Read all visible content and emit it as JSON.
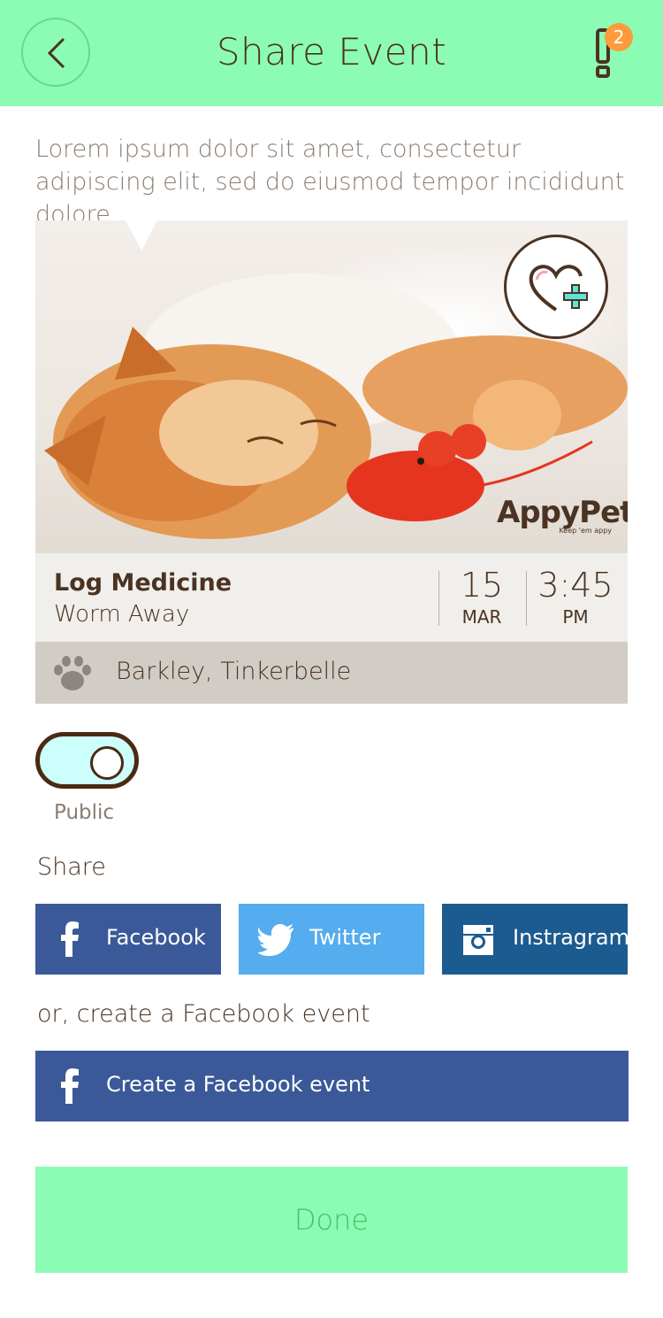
{
  "header": {
    "title": "Share Event",
    "back_icon": "chevron-left-icon",
    "alert_icon": "exclamation-icon",
    "alert_count": "2"
  },
  "intro": "Lorem ipsum dolor sit amet, consectetur adipiscing elit, sed do eiusmod tempor incididunt dolore.",
  "photo": {
    "alt": "Sleeping orange kitten with red toy mouse",
    "favorite_icon": "heart-plus-icon",
    "brand_name": "AppyPet",
    "brand_tagline": "Keep 'em appy"
  },
  "event": {
    "title": "Log Medicine",
    "subtitle": "Worm Away",
    "day": "15",
    "month": "MAR",
    "time": "3:45",
    "ampm": "PM"
  },
  "pets": {
    "icon": "paw-icon",
    "names": "Barkley, Tinkerbelle"
  },
  "visibility": {
    "label": "Public",
    "enabled": true
  },
  "share": {
    "label": "Share",
    "buttons": [
      {
        "label": "Facebook",
        "icon": "facebook-icon",
        "color": "#3b5998"
      },
      {
        "label": "Twitter",
        "icon": "twitter-icon",
        "color": "#55acee"
      },
      {
        "label": "Instragram",
        "icon": "instagram-icon",
        "color": "#1c5b8f"
      }
    ]
  },
  "facebook_event": {
    "prompt": "or, create a Facebook event",
    "button_label": "Create a Facebook event",
    "icon": "facebook-icon"
  },
  "done_label": "Done",
  "colors": {
    "header": "#8cfcb4",
    "text": "#4a3322",
    "badge": "#ff9b3d",
    "done_text": "#43c46d"
  }
}
